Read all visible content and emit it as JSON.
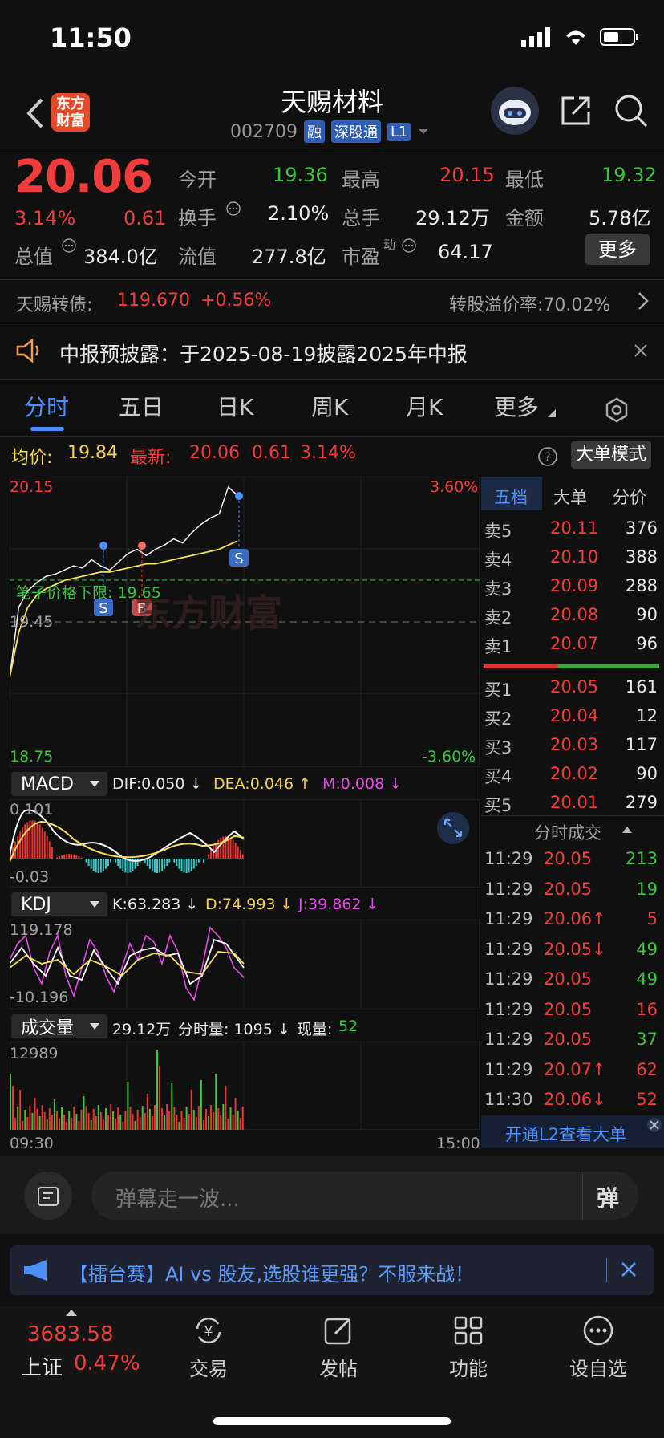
{
  "status": {
    "time": "11:50"
  },
  "header": {
    "logo_line1": "东方",
    "logo_line2": "财富",
    "title": "天赐材料",
    "code": "002709",
    "tags": [
      "融",
      "深股通",
      "L1"
    ]
  },
  "quote": {
    "price": "20.06",
    "change_pct": "3.14%",
    "change": "0.61",
    "open_label": "今开",
    "open": "19.36",
    "high_label": "最高",
    "high": "20.15",
    "low_label": "最低",
    "low": "19.32",
    "turnover_label": "换手",
    "turnover": "2.10%",
    "volume_label": "总手",
    "volume": "29.12万",
    "amount_label": "金额",
    "amount": "5.78亿",
    "mktcap_label": "总值",
    "mktcap": "384.0亿",
    "float_label": "流值",
    "float": "277.8亿",
    "pe_label": "市盈",
    "pe_sup": "动",
    "pe": "64.17",
    "more_btn": "更多"
  },
  "bond": {
    "name": "天赐转债:",
    "price": "119.670",
    "change": "+0.56%",
    "premium": "转股溢价率:70.02%"
  },
  "notice": {
    "text": "中报预披露：于2025-08-19披露2025年中报"
  },
  "tabs": [
    "分时",
    "五日",
    "日K",
    "周K",
    "月K",
    "更多"
  ],
  "chart": {
    "avg_label": "均价:",
    "avg": "19.84",
    "latest_label": "最新:",
    "latest": "20.06",
    "latest_chg": "0.61",
    "latest_pct": "3.14%",
    "mode_btn": "大单模式",
    "y_top": "20.15",
    "y_mid": "19.45",
    "y_bottom": "18.75",
    "pct_top": "3.60%",
    "pct_bottom": "-3.60%",
    "limit_label": "笔子价格下限: 19.65",
    "watermark": "东方财富",
    "time_start": "09:30",
    "time_end": "15:00"
  },
  "chart_data": {
    "type": "line",
    "title": "",
    "x_range": [
      "09:30",
      "15:00"
    ],
    "ylim": [
      18.75,
      20.15
    ],
    "series": [
      {
        "values": [
          19.18,
          19.52,
          19.6,
          19.64,
          19.67,
          19.68,
          19.7,
          19.72,
          19.71,
          19.75,
          19.72,
          19.7,
          19.74,
          19.78,
          19.8,
          19.77,
          19.8,
          19.82,
          19.85,
          19.83,
          19.88,
          19.92,
          19.95,
          19.97,
          20.1,
          20.06
        ]
      },
      {
        "values": [
          19.18,
          19.4,
          19.52,
          19.58,
          19.61,
          19.63,
          19.65,
          19.66,
          19.67,
          19.68,
          19.69,
          19.69,
          19.7,
          19.71,
          19.72,
          19.73,
          19.73,
          19.74,
          19.75,
          19.76,
          19.77,
          19.78,
          19.79,
          19.8,
          19.82,
          19.84
        ]
      }
    ]
  },
  "macd": {
    "name": "MACD",
    "dif": "DIF:0.050 ↓",
    "dea": "DEA:0.046 ↑",
    "m": "M:0.008 ↓",
    "y_top": "0.101",
    "y_bottom": "-0.03"
  },
  "kdj": {
    "name": "KDJ",
    "k": "K:63.283 ↓",
    "d": "D:74.993 ↓",
    "j": "J:39.862 ↓",
    "y_top": "119.178",
    "y_bottom": "-10.196"
  },
  "volume": {
    "name": "成交量",
    "total": "29.12万",
    "period": "分时量: 1095 ↓",
    "now_label": "现量:",
    "now": "52",
    "y_top": "12989"
  },
  "orderbook": {
    "tabs": [
      "五档",
      "大单",
      "分价"
    ],
    "sell": [
      {
        "label": "卖5",
        "price": "20.11",
        "vol": "376"
      },
      {
        "label": "卖4",
        "price": "20.10",
        "vol": "388"
      },
      {
        "label": "卖3",
        "price": "20.09",
        "vol": "288"
      },
      {
        "label": "卖2",
        "price": "20.08",
        "vol": "90"
      },
      {
        "label": "卖1",
        "price": "20.07",
        "vol": "96"
      }
    ],
    "buy": [
      {
        "label": "买1",
        "price": "20.05",
        "vol": "161"
      },
      {
        "label": "买2",
        "price": "20.04",
        "vol": "12"
      },
      {
        "label": "买3",
        "price": "20.03",
        "vol": "117"
      },
      {
        "label": "买4",
        "price": "20.02",
        "vol": "90"
      },
      {
        "label": "买5",
        "price": "20.01",
        "vol": "279"
      }
    ],
    "ticks_title": "分时成交",
    "ticks": [
      {
        "time": "11:29",
        "price": "20.05",
        "vol": "213"
      },
      {
        "time": "11:29",
        "price": "20.05",
        "vol": "19"
      },
      {
        "time": "11:29",
        "price": "20.06↑",
        "vol": "5"
      },
      {
        "time": "11:29",
        "price": "20.05↓",
        "vol": "49"
      },
      {
        "time": "11:29",
        "price": "20.05",
        "vol": "49"
      },
      {
        "time": "11:29",
        "price": "20.05",
        "vol": "16"
      },
      {
        "time": "11:29",
        "price": "20.05",
        "vol": "37"
      },
      {
        "time": "11:29",
        "price": "20.07↑",
        "vol": "62"
      },
      {
        "time": "11:30",
        "price": "20.06↓",
        "vol": "52"
      }
    ],
    "l2_text": "开通L2查看大单"
  },
  "comment": {
    "placeholder": "弹幕走一波...",
    "send": "弹"
  },
  "banner": {
    "text": "【擂台赛】AI vs 股友,选股谁更强？不服来战！"
  },
  "nav": {
    "index_value": "3683.58",
    "index_name": "上证",
    "index_pct": "0.47%",
    "items": [
      "交易",
      "发帖",
      "功能",
      "设自选"
    ]
  }
}
